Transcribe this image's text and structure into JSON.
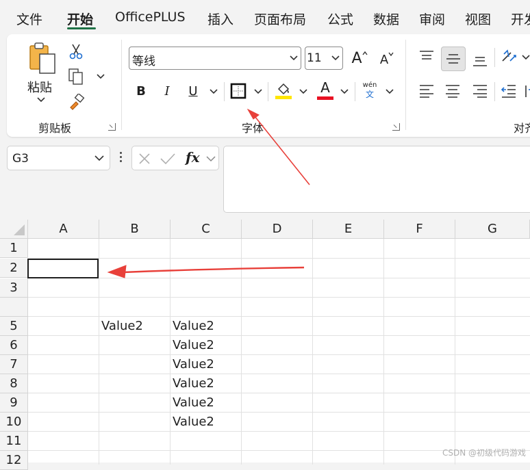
{
  "menu": {
    "tabs": [
      "文件",
      "开始",
      "OfficePLUS",
      "插入",
      "页面布局",
      "公式",
      "数据",
      "审阅",
      "视图",
      "开发"
    ],
    "active": "开始"
  },
  "ribbon": {
    "clipboard": {
      "paste_label": "粘贴",
      "group_label": "剪贴板"
    },
    "font": {
      "font_name": "等线",
      "font_size": "11",
      "bold": "B",
      "italic": "I",
      "underline": "U",
      "grow_font": "A",
      "shrink_font": "A",
      "font_color_glyph": "A",
      "phonetic_top": "wén",
      "phonetic_bottom": "文",
      "group_label": "字体",
      "fill_color": "#ffe600",
      "font_color": "#e81123"
    },
    "alignment": {
      "group_label": "对齐"
    }
  },
  "formula_bar": {
    "name_box": "G3",
    "fx": "fx",
    "formula": ""
  },
  "sheet": {
    "columns": [
      "A",
      "B",
      "C",
      "D",
      "E",
      "F",
      "G"
    ],
    "rows": [
      "1",
      "2",
      "3",
      "",
      "5",
      "6",
      "7",
      "8",
      "9",
      "10",
      "11",
      "12"
    ],
    "cells": {
      "B5": "Value2",
      "C5": "Value2",
      "C6": "Value2",
      "C7": "Value2",
      "C8": "Value2",
      "C9": "Value2",
      "C10": "Value2"
    },
    "selected_cell": "A2"
  },
  "annotation_color": "#e8403a",
  "watermark": "CSDN @初级代码游戏"
}
